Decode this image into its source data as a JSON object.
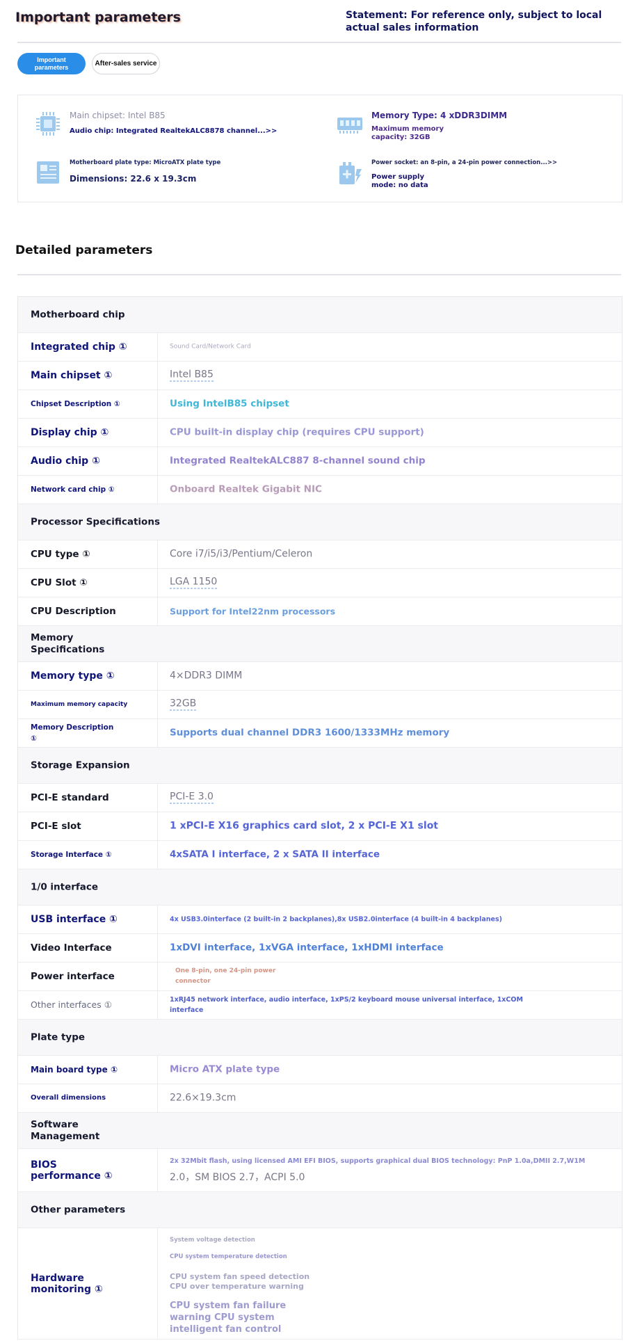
{
  "header": {
    "title": "Important parameters",
    "statement": "Statement: For reference only, subject to local actual sales information"
  },
  "tabs": [
    {
      "label": "Important parameters",
      "active": true
    },
    {
      "label": "After-sales service",
      "active": false
    }
  ],
  "summary": {
    "main_chipset": "Main chipset: Intel B85",
    "audio_chip": "Audio chip: Integrated RealtekALC8878 channel...>>",
    "memory_type": "Memory Type: 4 xDDR3DIMM",
    "max_memory": "Maximum memory capacity: 32GB",
    "plate_type": "Motherboard plate type: MicroATX plate type",
    "dimensions": "Dimensions: 22.6 x 19.3cm",
    "power_socket": "Power socket: an 8-pin, a 24-pin power connection...>>",
    "power_supply": "Power supply mode: no data",
    "icons": [
      "chip-icon",
      "memory-icon",
      "board-icon",
      "power-icon"
    ],
    "accent": "#2a8ee9"
  },
  "detail": {
    "title": "Detailed parameters",
    "sections": [
      {
        "name": "Motherboard chip",
        "rows": [
          {
            "key": "Integrated chip ①",
            "value": "Sound Card/Network Card"
          },
          {
            "key": "Main chipset ①",
            "value": "Intel B85"
          },
          {
            "key": "Chipset Description ①",
            "value": "Using IntelB85 chipset"
          },
          {
            "key": "Display chip ①",
            "value": "CPU built-in display chip (requires CPU support)"
          },
          {
            "key": "Audio chip ①",
            "value": "Integrated RealtekALC887 8-channel sound chip"
          },
          {
            "key": "Network card chip ①",
            "value": "Onboard Realtek Gigabit NIC"
          }
        ]
      },
      {
        "name": "Processor Specifications",
        "rows": [
          {
            "key": "CPU type ①",
            "value": "Core i7/i5/i3/Pentium/Celeron"
          },
          {
            "key": "CPU Slot ①",
            "value": "LGA 1150"
          },
          {
            "key": "CPU Description",
            "value": "Support for Intel22nm processors"
          }
        ]
      },
      {
        "name": "Memory Specifications",
        "rows": [
          {
            "key": "Memory type ①",
            "value": "4×DDR3 DIMM"
          },
          {
            "key": "Maximum memory capacity",
            "value": "32GB"
          },
          {
            "key": "Memory Description ①",
            "value": "Supports dual channel DDR3 1600/1333MHz memory"
          }
        ]
      },
      {
        "name": "Storage Expansion",
        "rows": [
          {
            "key": "PCI-E standard",
            "value": "PCI-E 3.0"
          },
          {
            "key": "PCI-E slot",
            "value": "1 xPCI-E X16 graphics card slot, 2 x PCI-E X1 slot"
          },
          {
            "key": "Storage Interface ①",
            "value": "4xSATA I interface, 2 x SATA II interface"
          }
        ]
      },
      {
        "name": "1/0 interface",
        "rows": [
          {
            "key": "USB interface ①",
            "value": "4x USB3.0interface (2 built-in 2 backplanes),8x USB2.0interface (4 built-in 4 backplanes)"
          },
          {
            "key": "Video Interface",
            "value": "1xDVI interface, 1xVGA interface, 1xHDMI interface"
          },
          {
            "key": "Power interface",
            "value": "One 8-pin, one 24-pin power connector"
          },
          {
            "key": "Other interfaces ①",
            "value": "1xRJ45 network interface, audio interface, 1xPS/2 keyboard mouse universal interface, 1xCOM interface"
          }
        ]
      },
      {
        "name": "Plate type",
        "rows": [
          {
            "key": "Main board type ①",
            "value": "Micro ATX plate type"
          },
          {
            "key": "Overall dimensions",
            "value": "22.6×19.3cm"
          }
        ]
      },
      {
        "name": "Software Management",
        "rows": [
          {
            "key": "BIOS performance ①",
            "value": "2x 32Mbit flash, using licensed AMI EFI BIOS, supports graphical dual BIOS technology: PnP 1.0a,DMII 2.7,W1M",
            "value2": "2.0，SM BIOS 2.7，ACPI 5.0"
          }
        ]
      },
      {
        "name": "Other parameters",
        "rows": [
          {
            "key": "Hardware monitoring ①",
            "lines": [
              "System voltage detection",
              "CPU system temperature detection",
              "CPU system fan speed detection CPU over temperature warning",
              "CPU system fan failure warning CPU system intelligent fan control"
            ]
          }
        ]
      }
    ]
  }
}
